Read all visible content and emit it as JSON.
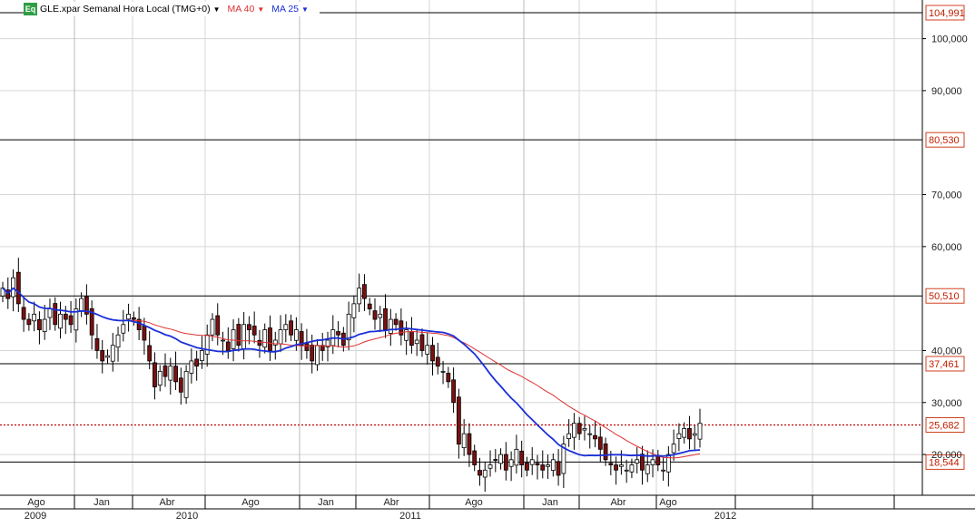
{
  "legend": {
    "symbol_badge": "Eq",
    "series_label": "GLE.xpar Semanal Hora Local (TMG+0)",
    "ma40_label": "MA 40",
    "ma25_label": "MA 25",
    "ma40_color": "#e03030",
    "ma25_color": "#1a2fd8"
  },
  "chart_data": {
    "type": "candlestick",
    "title": "",
    "xlabel": "",
    "ylabel": "",
    "ylim": [
      10,
      107
    ],
    "y_ticks": [
      "100,000",
      "90,000",
      "70,000",
      "60,000",
      "40,000",
      "30,000",
      "20,000"
    ],
    "y_tick_values": [
      100,
      90,
      70,
      60,
      40,
      30,
      20
    ],
    "x_month_labels": [
      "Ago",
      "Jan",
      "Abr",
      "Ago",
      "Jan",
      "Abr",
      "Ago",
      "Jan",
      "Abr",
      "Ago"
    ],
    "x_year_labels": [
      "2009",
      "2010",
      "2011",
      "2012"
    ],
    "horizontal_lines": [
      {
        "value": 104.991,
        "label": "104,991",
        "style": "solid"
      },
      {
        "value": 80.53,
        "label": "80,530",
        "style": "solid"
      },
      {
        "value": 50.51,
        "label": "50,510",
        "style": "solid"
      },
      {
        "value": 37.461,
        "label": "37,461",
        "style": "solid"
      },
      {
        "value": 25.682,
        "label": "25,682",
        "style": "dotted"
      },
      {
        "value": 18.544,
        "label": "18,544",
        "style": "solid"
      }
    ],
    "candles_close": [
      52,
      50,
      54,
      49,
      46,
      45,
      47,
      44,
      46,
      48,
      45,
      47,
      46,
      45,
      48,
      50,
      47,
      43,
      40,
      38,
      39,
      41,
      43,
      45,
      47,
      46,
      44,
      42,
      38,
      33,
      36,
      35,
      37,
      34,
      32,
      36,
      38,
      37,
      40,
      43,
      46,
      43,
      42,
      40,
      44,
      41,
      45,
      44,
      43,
      41,
      44,
      40,
      42,
      44,
      45,
      43,
      44,
      41,
      40,
      38,
      41,
      40,
      42,
      44,
      43,
      41,
      47,
      49,
      52,
      50,
      48,
      46,
      47,
      44,
      46,
      45,
      43,
      44,
      41,
      42,
      40,
      41,
      38,
      37,
      36,
      34,
      30,
      22,
      24,
      20,
      18,
      16,
      17,
      18,
      19,
      20,
      17,
      19,
      21,
      18,
      17,
      19,
      18,
      17,
      18,
      19,
      16,
      22,
      24,
      26,
      24,
      25,
      24,
      23,
      21,
      19,
      18,
      17,
      18,
      17,
      18,
      19,
      17,
      18,
      19,
      18,
      17,
      20,
      22,
      24,
      25,
      23,
      24,
      26
    ],
    "series": [
      {
        "name": "MA 40",
        "color": "#e03030"
      },
      {
        "name": "MA 25",
        "color": "#1a2fd8"
      }
    ]
  }
}
